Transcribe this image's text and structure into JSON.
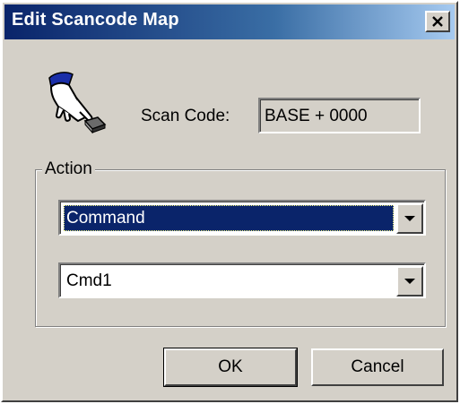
{
  "window": {
    "title": "Edit Scancode Map",
    "close_icon": "close-icon"
  },
  "scan": {
    "icon": "hand-pointer-icon",
    "label": "Scan Code:",
    "value": "BASE + 0000"
  },
  "action": {
    "group_label": "Action",
    "type_select": {
      "value": "Command",
      "icon": "chevron-down-icon"
    },
    "command_select": {
      "value": "Cmd1",
      "icon": "chevron-down-icon"
    }
  },
  "buttons": {
    "ok_label": "OK",
    "cancel_label": "Cancel"
  },
  "colors": {
    "titlebar_start": "#0a246a",
    "titlebar_end": "#a6caf0",
    "face": "#d4d0c8",
    "selection": "#0a246a"
  }
}
